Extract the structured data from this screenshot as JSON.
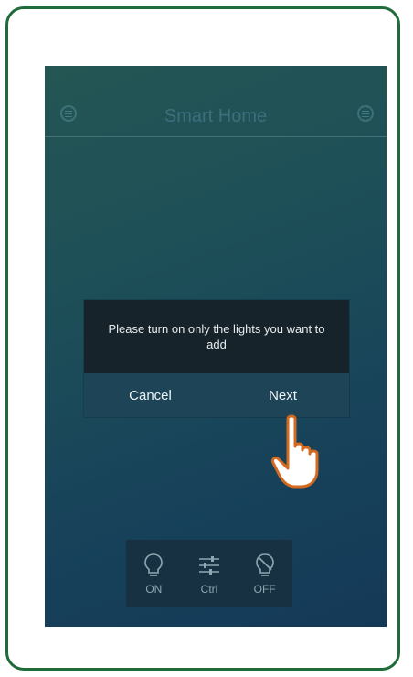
{
  "app": {
    "title": "Smart Home"
  },
  "header": {
    "left_icon": "menu-icon",
    "right_icon": "list-icon"
  },
  "dialog": {
    "message": "Please turn on only the lights you want to add",
    "cancel_label": "Cancel",
    "next_label": "Next"
  },
  "toolbar": {
    "items": [
      {
        "label": "ON",
        "icon": "bulb-icon"
      },
      {
        "label": "Ctrl",
        "icon": "sliders-icon"
      },
      {
        "label": "OFF",
        "icon": "bulb-off-icon"
      }
    ]
  },
  "colors": {
    "frame_border": "#1f6b3a",
    "hand_outline": "#d36a1f",
    "dialog_message_bg": "#17232a",
    "dialog_actions_bg": "#1d4457"
  }
}
